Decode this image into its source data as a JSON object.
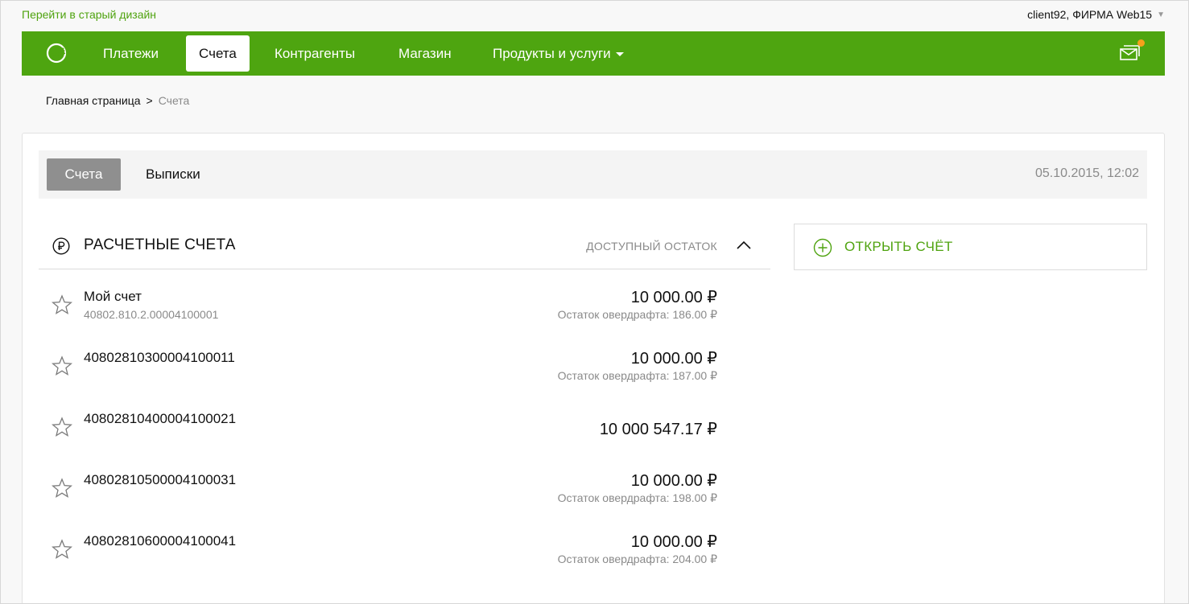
{
  "topbar": {
    "old_design_link": "Перейти в старый дизайн",
    "user": "client92, ФИРМА Web15"
  },
  "nav": {
    "items": [
      {
        "label": "Платежи"
      },
      {
        "label": "Счета"
      },
      {
        "label": "Контрагенты"
      },
      {
        "label": "Магазин"
      },
      {
        "label": "Продукты и услуги"
      }
    ],
    "active": "Счета"
  },
  "breadcrumb": {
    "home": "Главная страница",
    "separator": ">",
    "current": "Счета"
  },
  "tabs": {
    "accounts": "Счета",
    "statements": "Выписки",
    "timestamp": "05.10.2015, 12:02"
  },
  "section": {
    "title": "РАСЧЕТНЫЕ СЧЕТА",
    "balance_label": "ДОСТУПНЫЙ ОСТАТОК"
  },
  "accounts": [
    {
      "name": "Мой счет",
      "number": "40802.810.2.00004100001",
      "amount": "10 000.00 ₽",
      "overdraft": "Остаток овердрафта: 186.00 ₽"
    },
    {
      "name": "40802810300004100011",
      "number": "",
      "amount": "10 000.00 ₽",
      "overdraft": "Остаток овердрафта: 187.00 ₽"
    },
    {
      "name": "40802810400004100021",
      "number": "",
      "amount": "10 000 547.17 ₽",
      "overdraft": ""
    },
    {
      "name": "40802810500004100031",
      "number": "",
      "amount": "10 000.00 ₽",
      "overdraft": "Остаток овердрафта: 198.00 ₽"
    },
    {
      "name": "40802810600004100041",
      "number": "",
      "amount": "10 000.00 ₽",
      "overdraft": "Остаток овердрафта: 204.00 ₽"
    }
  ],
  "open_account": {
    "label": "ОТКРЫТЬ СЧЁТ"
  },
  "icons": {
    "logo": "sber-logo-icon",
    "mail": "messages-icon",
    "notification_dot_color": "#f5a11b",
    "ruble": "ruble-circle-icon",
    "collapse": "chevron-up-icon",
    "star": "star-outline-icon",
    "plus": "plus-circle-icon"
  },
  "colors": {
    "brand_green": "#4ea510",
    "link_green": "#4fa30f",
    "active_tab_gray": "#8f8f8f"
  }
}
